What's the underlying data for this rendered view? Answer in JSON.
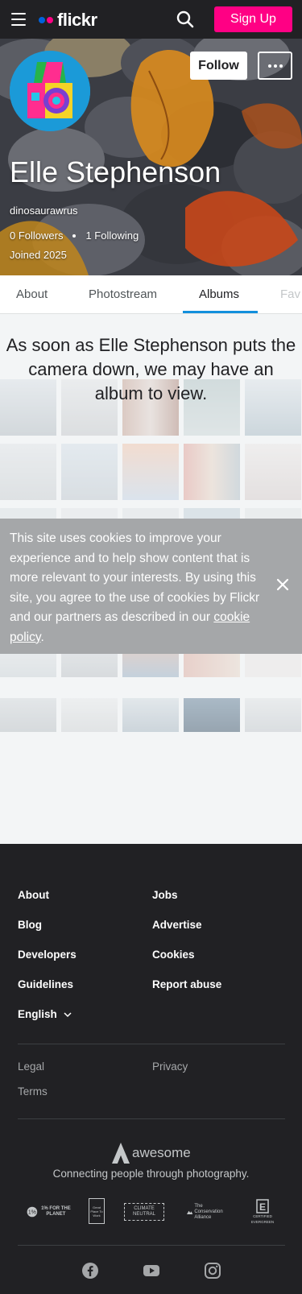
{
  "topbar": {
    "logo_text": "flickr",
    "signup_label": "Sign Up"
  },
  "profile": {
    "name": "Elle Stephenson",
    "username": "dinosaurawrus",
    "followers": "0 Followers",
    "following": "1 Following",
    "joined": "Joined 2025",
    "follow_label": "Follow"
  },
  "tabs": [
    {
      "label": "About",
      "active": false
    },
    {
      "label": "Photostream",
      "active": false
    },
    {
      "label": "Albums",
      "active": true
    },
    {
      "label": "Fav",
      "active": false
    }
  ],
  "empty_state": {
    "message": "As soon as Elle Stephenson puts the camera down, we may have an album to view."
  },
  "cookie_banner": {
    "text": "This site uses cookies to improve your experience and to help show content that is more relevant to your interests. By using this site, you agree to the use of cookies by Flickr and our partners as described in our",
    "link_text": "cookie policy",
    "suffix": "."
  },
  "footer": {
    "links_left": [
      "About",
      "Blog",
      "Developers",
      "Guidelines"
    ],
    "links_right": [
      "Jobs",
      "Advertise",
      "Cookies",
      "Report abuse"
    ],
    "language": "English",
    "legal": "Legal",
    "privacy": "Privacy",
    "terms": "Terms",
    "brand": "awesome",
    "tagline": "Connecting people through photography.",
    "badges": [
      "1% FOR THE PLANET",
      "Great Place To Work",
      "CLIMATE NEUTRAL",
      "The Conservation Alliance",
      "CERTIFIED EVERGREEN"
    ],
    "social": [
      "facebook",
      "youtube",
      "instagram"
    ]
  },
  "colors": {
    "accent": "#ff0084",
    "brand_blue": "#0063dc",
    "tab_underline": "#128fdc",
    "footer_bg": "#212124",
    "cookie_bg": "#a5a7a9"
  }
}
